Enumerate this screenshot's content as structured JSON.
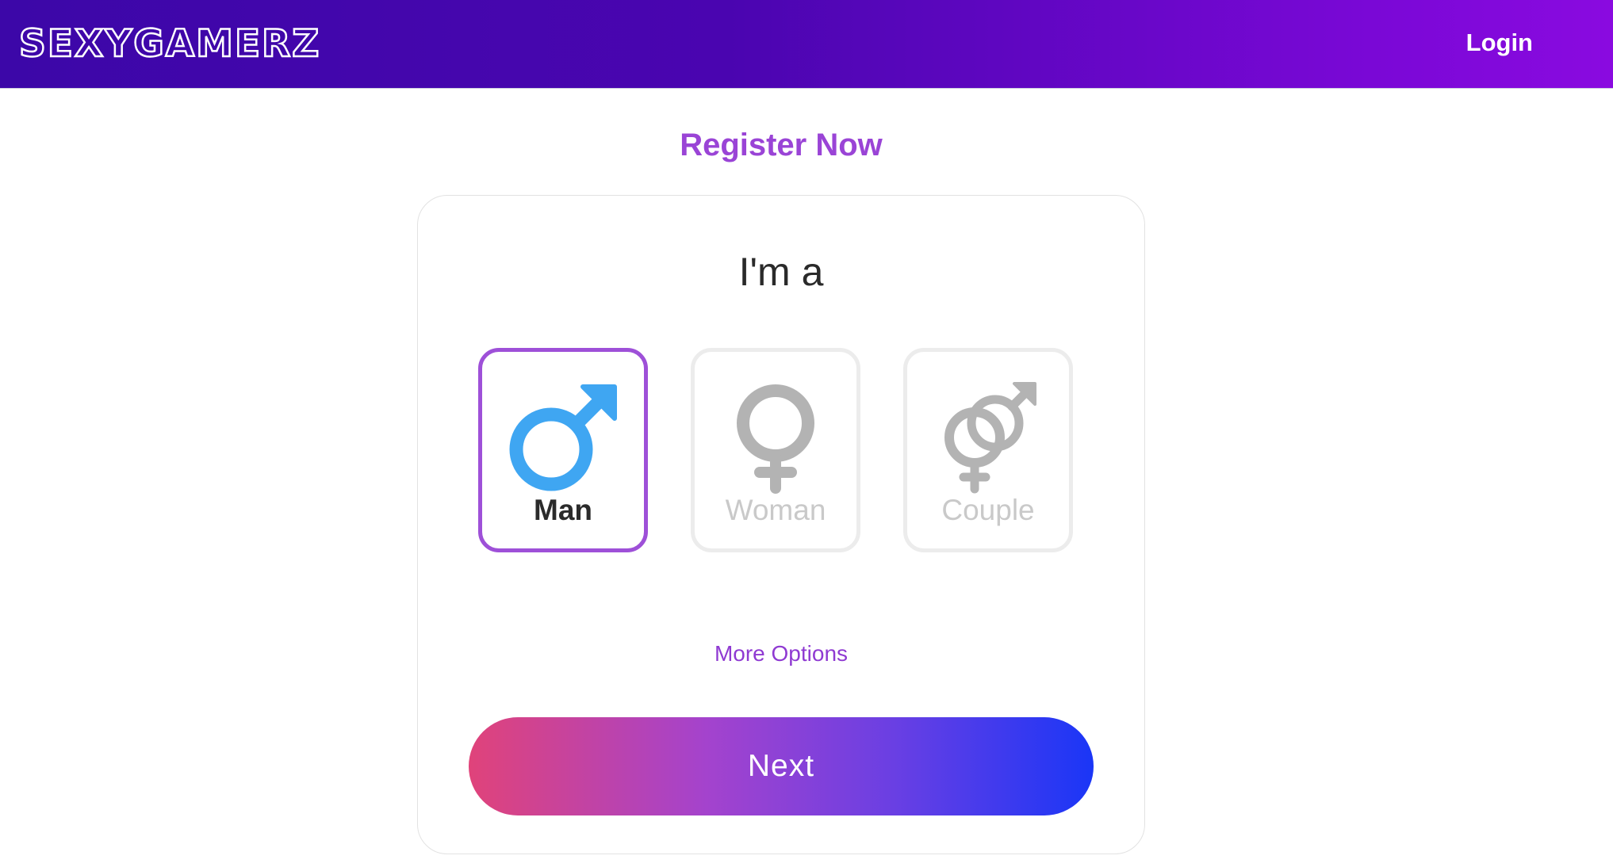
{
  "header": {
    "logo_text": "SEXYGAMERZ",
    "login_label": "Login"
  },
  "registration": {
    "title": "Register Now",
    "prompt": "I'm a",
    "options": [
      {
        "label": "Man",
        "icon": "male-symbol-icon",
        "selected": true
      },
      {
        "label": "Woman",
        "icon": "female-symbol-icon",
        "selected": false
      },
      {
        "label": "Couple",
        "icon": "couple-symbol-icon",
        "selected": false
      }
    ],
    "more_options_label": "More Options",
    "next_label": "Next"
  },
  "colors": {
    "brand_purple": "#9a44d6",
    "male_blue": "#3fa6f2",
    "unselected_gray": "#b3b3b3",
    "selected_border": "#9e50d8"
  }
}
